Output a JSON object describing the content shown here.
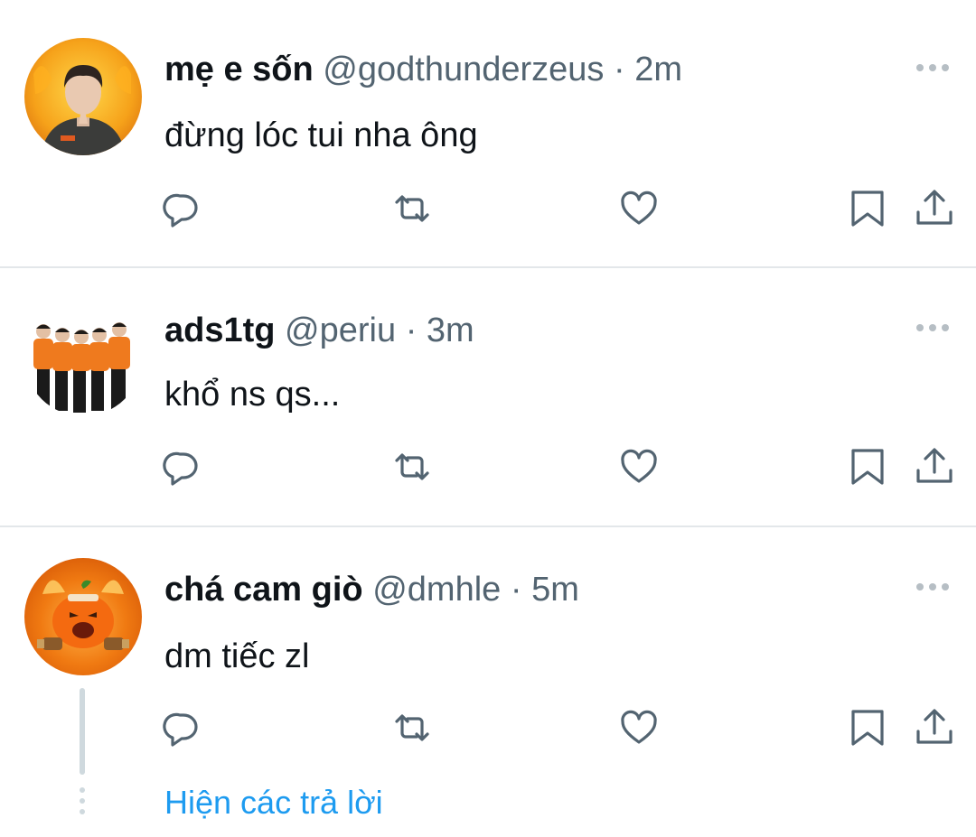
{
  "tweets": [
    {
      "name": "mẹ e sốn",
      "handle": "@godthunderzeus",
      "separator": "·",
      "time": "2m",
      "text": "đừng lóc tui nha ông",
      "avatar_desc": "person-praying-avatar"
    },
    {
      "name": "ads1tg",
      "handle": "@periu",
      "separator": "·",
      "time": "3m",
      "text": "khổ ns qs...",
      "avatar_desc": "team-photo-avatar"
    },
    {
      "name": "chá cam giò",
      "handle": "@dmhle",
      "separator": "·",
      "time": "5m",
      "text": "dm tiếc zl",
      "avatar_desc": "angry-orange-avatar"
    }
  ],
  "show_replies_label": "Hiện các trả lời",
  "icons": [
    "reply-icon",
    "retweet-icon",
    "like-icon",
    "bookmark-icon",
    "share-icon",
    "more-icon"
  ],
  "colors": {
    "text": "#0f1419",
    "secondary": "#536471",
    "icon": "#536471",
    "link": "#1d9bf0",
    "divider": "#e3e7ea",
    "thread": "#cfd9de"
  }
}
